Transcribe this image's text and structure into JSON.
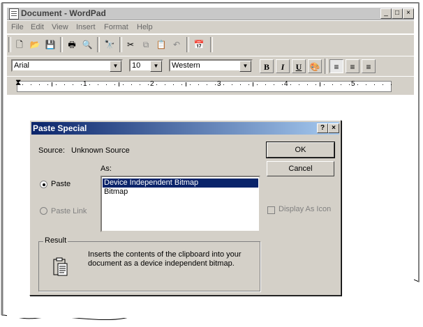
{
  "window": {
    "title": "Document - WordPad",
    "controls": [
      "_",
      "□",
      "×"
    ]
  },
  "menu": [
    "File",
    "Edit",
    "View",
    "Insert",
    "Format",
    "Help"
  ],
  "toolbar": {
    "icons": [
      "new-icon",
      "open-icon",
      "save-icon",
      "print-icon",
      "print-preview-icon",
      "find-icon",
      "cut-icon",
      "copy-icon",
      "paste-icon",
      "undo-icon",
      "date-time-icon"
    ]
  },
  "format_bar": {
    "font": "Arial",
    "size": "10",
    "script": "Western",
    "bold": "B",
    "italic": "I",
    "underline": "U"
  },
  "ruler": {
    "numbers": [
      "1",
      "2",
      "3",
      "4",
      "5"
    ]
  },
  "dialog": {
    "title": "Paste Special",
    "help": "?",
    "close": "×",
    "source_label": "Source:",
    "source_value": "Unknown Source",
    "as_label": "As:",
    "paste_label": "Paste",
    "paste_link_label": "Paste Link",
    "as_items": [
      "Device Independent Bitmap",
      "Bitmap"
    ],
    "ok": "OK",
    "cancel": "Cancel",
    "display_as_icon": "Display As Icon",
    "result_label": "Result",
    "result_text": "Inserts the contents of the clipboard into your document as a device independent bitmap."
  }
}
